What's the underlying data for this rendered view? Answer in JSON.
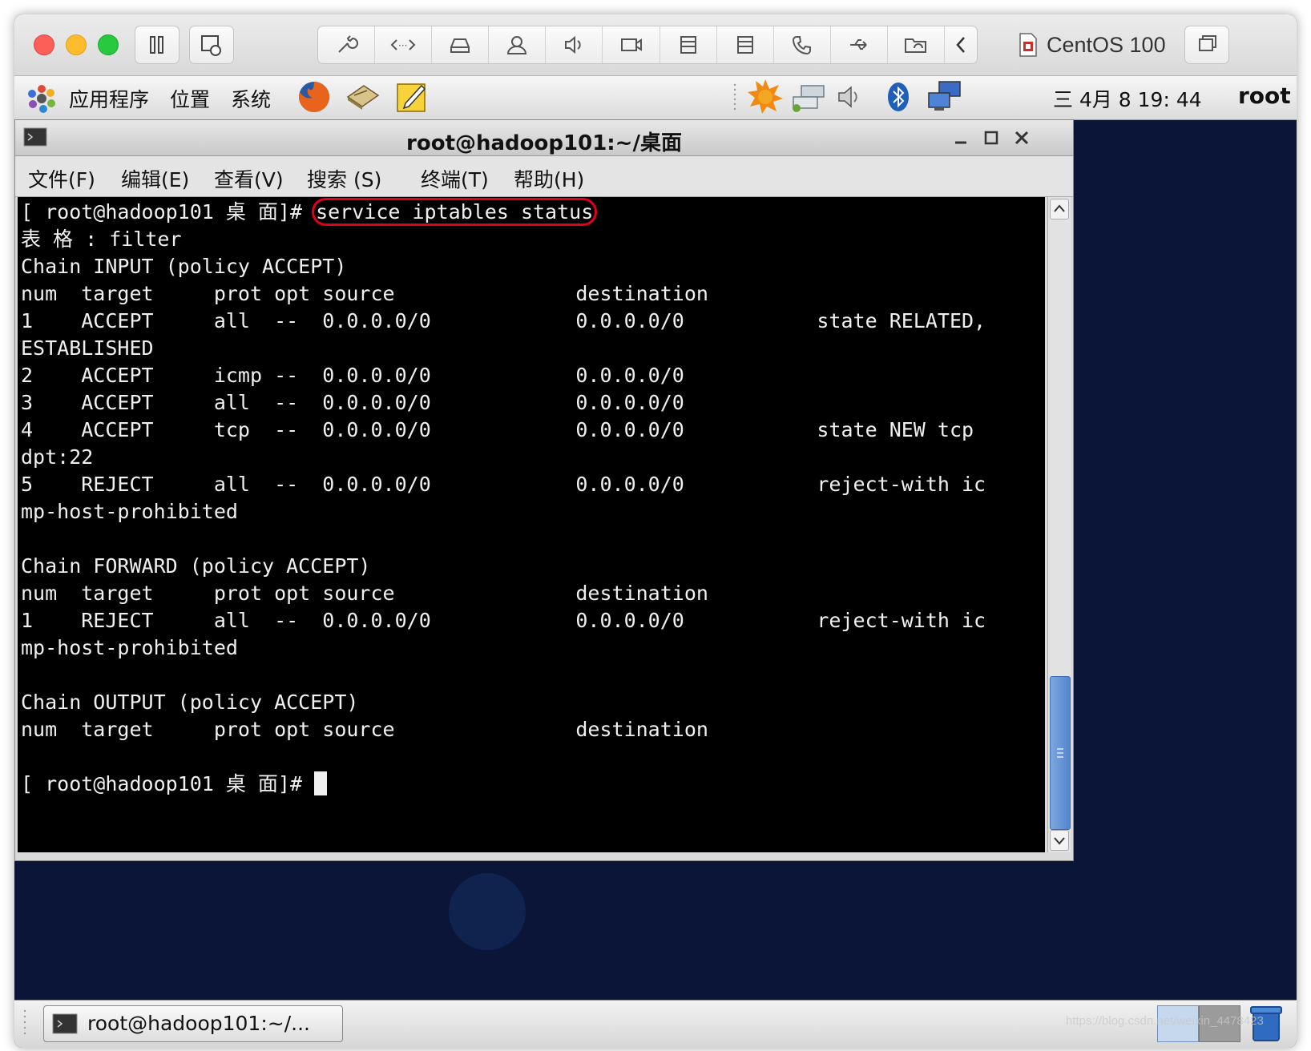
{
  "mac_toolbar": {
    "vm_name": "CentOS 100"
  },
  "top_panel": {
    "menus": [
      "应用程序",
      "位置",
      "系统"
    ],
    "clock": "三 4月   8 19: 44",
    "user": "root"
  },
  "terminal": {
    "title": "root@hadoop101:~/桌面",
    "menus": [
      "文件(F)",
      "编辑(E)",
      "查看(V)",
      "搜索 (S)",
      "终端(T)",
      "帮助(H)"
    ],
    "prompt": "[ root@hadoop101 桌 面]# ",
    "command": "service iptables status",
    "output_lines": [
      "表 格 : filter",
      "Chain INPUT (policy ACCEPT)",
      "num  target     prot opt source               destination",
      "1    ACCEPT     all  --  0.0.0.0/0            0.0.0.0/0           state RELATED,",
      "ESTABLISHED",
      "2    ACCEPT     icmp --  0.0.0.0/0            0.0.0.0/0",
      "3    ACCEPT     all  --  0.0.0.0/0            0.0.0.0/0",
      "4    ACCEPT     tcp  --  0.0.0.0/0            0.0.0.0/0           state NEW tcp",
      "dpt:22",
      "5    REJECT     all  --  0.0.0.0/0            0.0.0.0/0           reject-with ic",
      "mp-host-prohibited",
      "",
      "Chain FORWARD (policy ACCEPT)",
      "num  target     prot opt source               destination",
      "1    REJECT     all  --  0.0.0.0/0            0.0.0.0/0           reject-with ic",
      "mp-host-prohibited",
      "",
      "Chain OUTPUT (policy ACCEPT)",
      "num  target     prot opt source               destination",
      ""
    ],
    "final_prompt": "[ root@hadoop101 桌 面]# "
  },
  "bottom_panel": {
    "task_label": "root@hadoop101:~/..."
  },
  "watermark": "https://blog.csdn.net/weixin_4478423",
  "colors": {
    "desktop": "#0a1538",
    "terminal_bg": "#000000",
    "terminal_fg": "#f0f0f0",
    "highlight": "#e0001b",
    "scroll_thumb": "#5386cf"
  }
}
